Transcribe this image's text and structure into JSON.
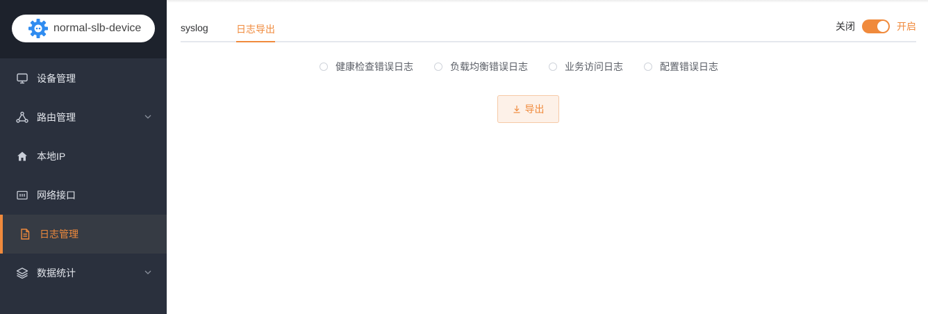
{
  "device": {
    "name": "normal-slb-device",
    "icon": "gear-icon",
    "icon_color": "#2f8cf0"
  },
  "sidebar": {
    "items": [
      {
        "label": "设备管理",
        "icon": "monitor-icon",
        "has_children": false,
        "active": false
      },
      {
        "label": "路由管理",
        "icon": "route-icon",
        "has_children": true,
        "active": false
      },
      {
        "label": "本地IP",
        "icon": "home-icon",
        "has_children": false,
        "active": false
      },
      {
        "label": "网络接口",
        "icon": "interface-icon",
        "has_children": false,
        "active": false
      },
      {
        "label": "日志管理",
        "icon": "document-icon",
        "has_children": false,
        "active": true
      },
      {
        "label": "数据统计",
        "icon": "layers-icon",
        "has_children": true,
        "active": false
      }
    ]
  },
  "tabs": [
    {
      "label": "syslog",
      "active": false
    },
    {
      "label": "日志导出",
      "active": true
    }
  ],
  "switch": {
    "off_label": "关闭",
    "on_label": "开启",
    "state": "on"
  },
  "log_types": [
    {
      "label": "健康检查错误日志",
      "checked": false
    },
    {
      "label": "负载均衡错误日志",
      "checked": false
    },
    {
      "label": "业务访问日志",
      "checked": false
    },
    {
      "label": "配置错误日志",
      "checked": false
    }
  ],
  "export_button": {
    "label": "导出",
    "icon": "download-icon"
  },
  "colors": {
    "accent": "#f08a3c",
    "sidebar_bg": "#2a303d",
    "sidebar_top_bg": "#1d222c",
    "active_item_bg": "#363b44"
  }
}
